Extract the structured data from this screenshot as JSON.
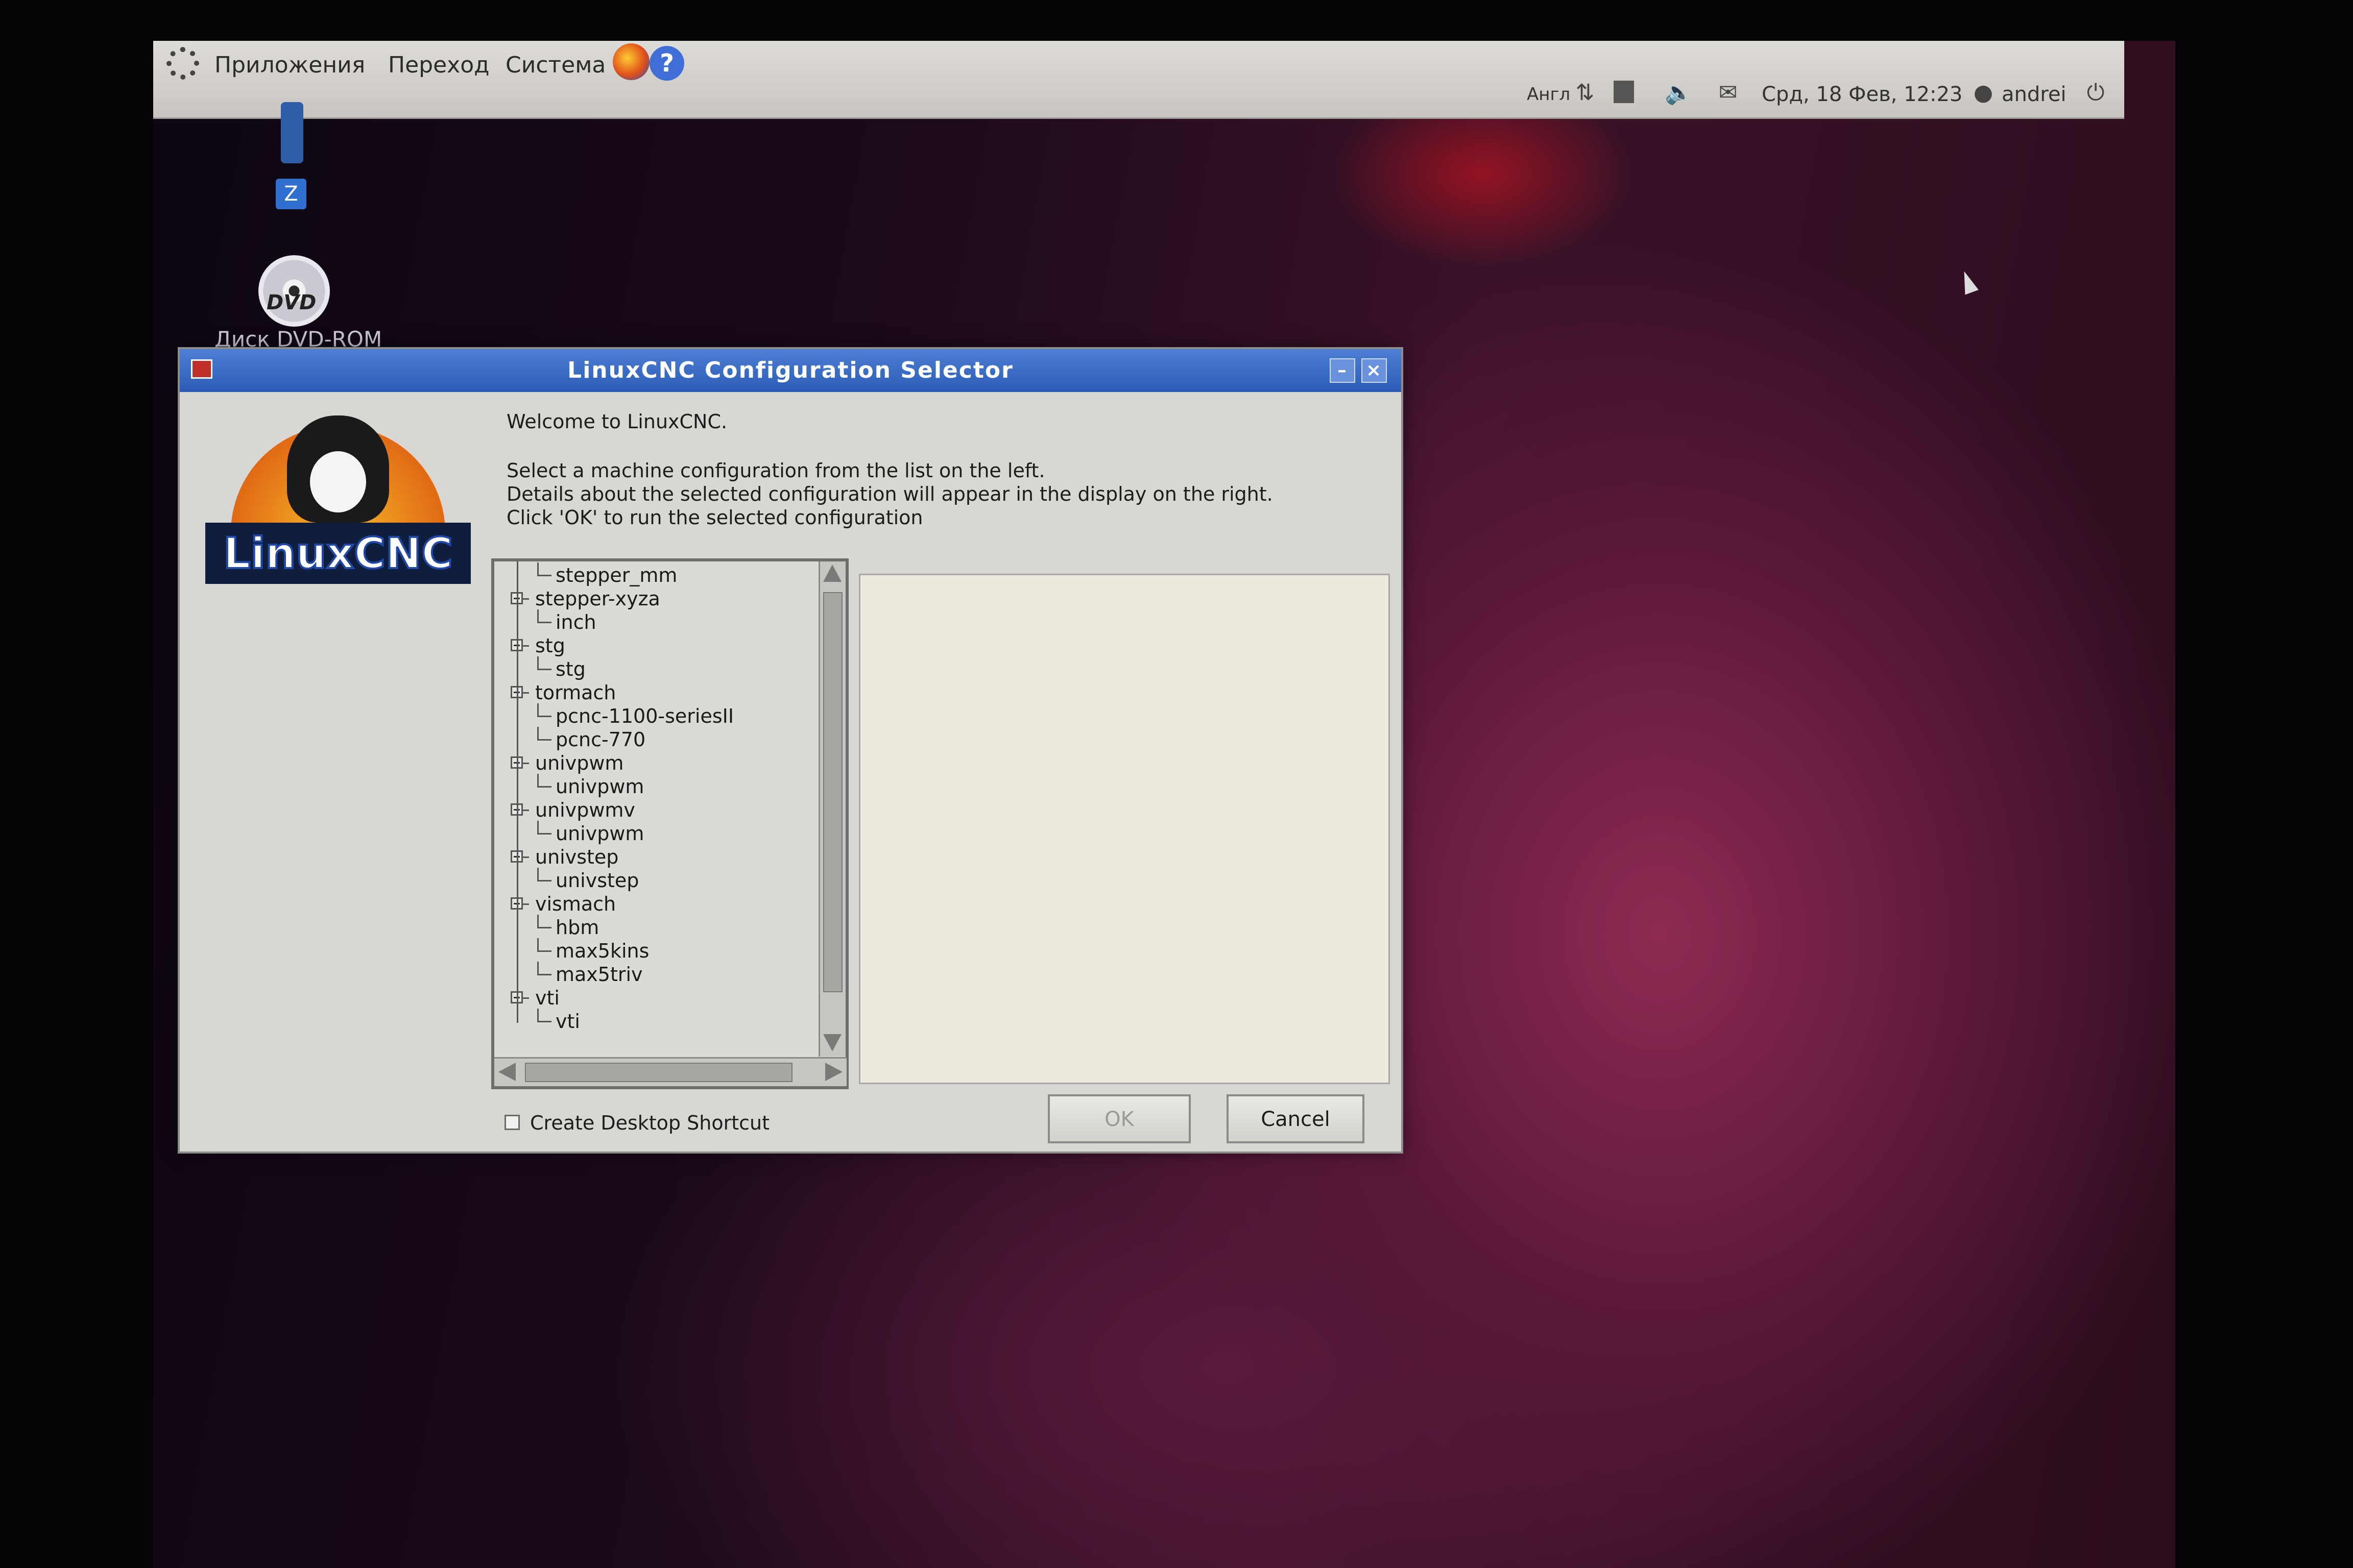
{
  "panel": {
    "menus": [
      "Приложения",
      "Переход",
      "Система"
    ],
    "keyboard_layout": "Англ",
    "datetime": "Срд, 18 Фев, 12:23",
    "user": "andrei"
  },
  "desktop": {
    "usb_label": "Z",
    "dvd_label": "Диск DVD-ROM",
    "dvd_text": "DVD"
  },
  "dialog": {
    "title": "LinuxCNC Configuration Selector",
    "logo_text": "LinuxCNC",
    "welcome": "Welcome to LinuxCNC.",
    "instructions": [
      "Select a machine configuration from the list on the left.",
      "Details about the selected configuration will appear in the display on the right.",
      "Click 'OK' to run the selected configuration"
    ],
    "tree": [
      {
        "label": "stepper_mm",
        "level": 2
      },
      {
        "label": "stepper-xyza",
        "level": 1
      },
      {
        "label": "inch",
        "level": 2
      },
      {
        "label": "stg",
        "level": 1
      },
      {
        "label": "stg",
        "level": 2
      },
      {
        "label": "tormach",
        "level": 1
      },
      {
        "label": "pcnc-1100-seriesII",
        "level": 2
      },
      {
        "label": "pcnc-770",
        "level": 2
      },
      {
        "label": "univpwm",
        "level": 1
      },
      {
        "label": "univpwm",
        "level": 2
      },
      {
        "label": "univpwmv",
        "level": 1
      },
      {
        "label": "univpwm",
        "level": 2
      },
      {
        "label": "univstep",
        "level": 1
      },
      {
        "label": "univstep",
        "level": 2
      },
      {
        "label": "vismach",
        "level": 1
      },
      {
        "label": "hbm",
        "level": 2
      },
      {
        "label": "max5kins",
        "level": 2
      },
      {
        "label": "max5triv",
        "level": 2
      },
      {
        "label": "vti",
        "level": 1
      },
      {
        "label": "vti",
        "level": 2
      }
    ],
    "checkbox_label": "Create Desktop Shortcut",
    "ok_label": "OK",
    "cancel_label": "Cancel"
  },
  "colors": {
    "titlebar": "#2a5cb6",
    "dialog_bg": "#d9d7d3",
    "details_bg": "#ece9de"
  }
}
